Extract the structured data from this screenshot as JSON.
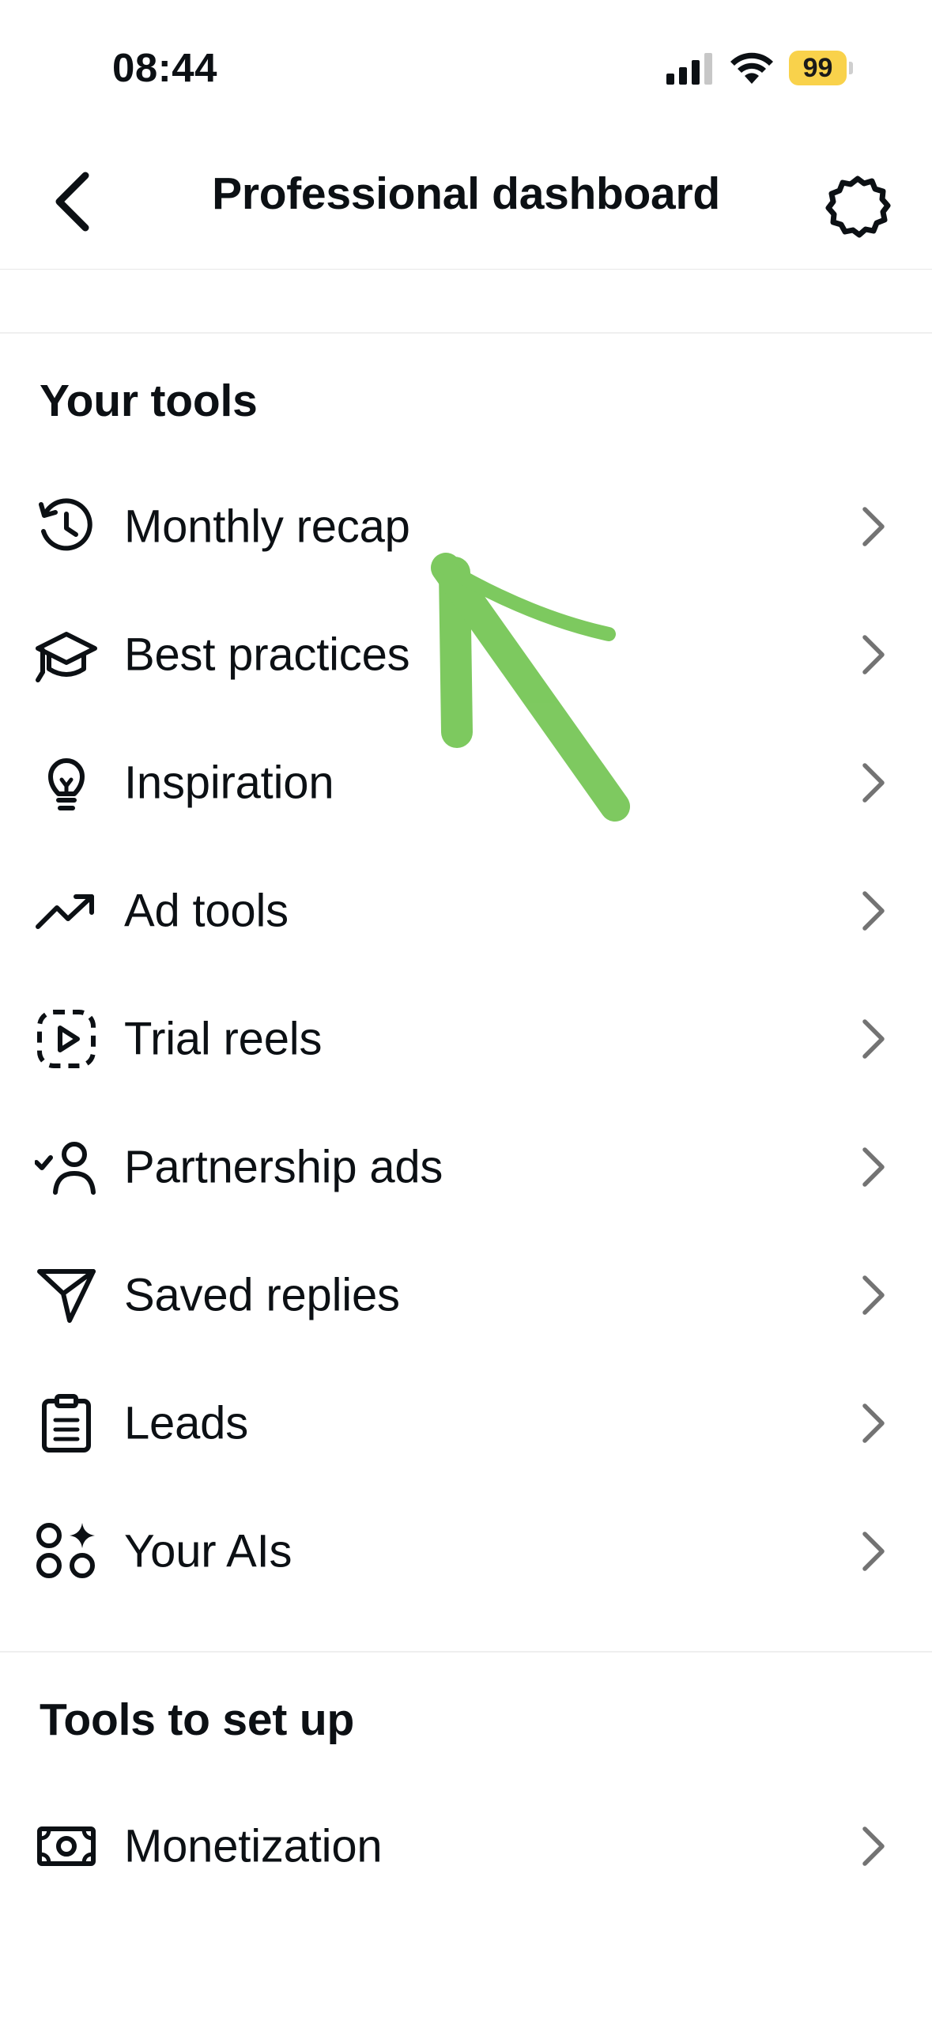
{
  "status_bar": {
    "time": "08:44",
    "battery": "99",
    "battery_color": "#f9d24b"
  },
  "header": {
    "title": "Professional dashboard",
    "back_icon": "chevron-left-icon",
    "settings_icon": "gear-icon"
  },
  "sections": {
    "your_tools": {
      "title": "Your tools",
      "items": [
        {
          "label": "Monthly recap",
          "icon": "history-clock-icon"
        },
        {
          "label": "Best practices",
          "icon": "graduation-cap-icon"
        },
        {
          "label": "Inspiration",
          "icon": "lightbulb-icon"
        },
        {
          "label": "Ad tools",
          "icon": "trending-up-icon"
        },
        {
          "label": "Trial reels",
          "icon": "trial-reel-icon"
        },
        {
          "label": "Partnership ads",
          "icon": "person-check-icon"
        },
        {
          "label": "Saved replies",
          "icon": "send-icon"
        },
        {
          "label": "Leads",
          "icon": "clipboard-icon"
        },
        {
          "label": "Your AIs",
          "icon": "ai-shapes-icon"
        }
      ]
    },
    "tools_to_set_up": {
      "title": "Tools to set up",
      "items": [
        {
          "label": "Monetization",
          "icon": "money-icon"
        }
      ]
    }
  },
  "annotation": {
    "color": "#6cc24a",
    "icon": "green-arrow-annotation"
  }
}
